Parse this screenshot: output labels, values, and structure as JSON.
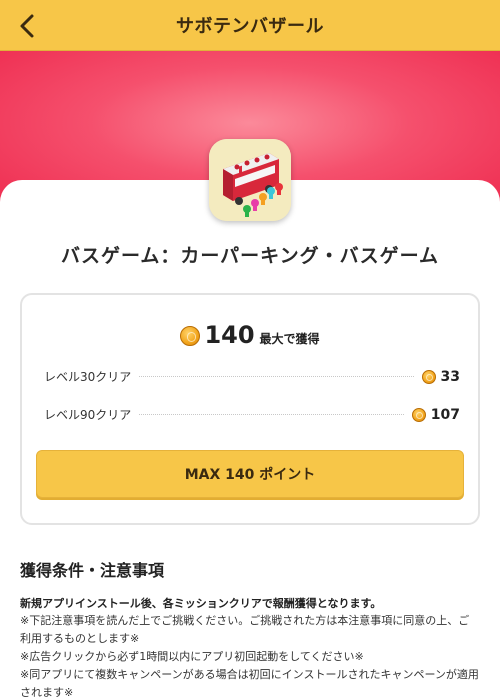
{
  "header": {
    "title": "サボテンバザール",
    "back_icon": "chevron-left-icon",
    "bg_color": "#f7c648"
  },
  "hero": {
    "gradient_color": "#f5506d"
  },
  "app": {
    "icon": "bus-game-app-icon",
    "title": "バスゲーム：カーパーキング・バスゲーム"
  },
  "reward": {
    "max_points": "140",
    "max_label": "最大で獲得",
    "levels": [
      {
        "label": "レベル30クリア",
        "points": "33"
      },
      {
        "label": "レベル90クリア",
        "points": "107"
      }
    ],
    "button_label": "MAX 140 ポイント"
  },
  "conditions": {
    "title": "獲得条件・注意事項",
    "lead": "新規アプリインストール後、各ミッションクリアで報酬獲得となります。",
    "notes": [
      "※下記注意事項を読んだ上でご挑戦ください。ご挑戦された方は本注意事項に同意の上、ご利用するものとします※",
      "※広告クリックから必ず1時間以内にアプリ初回起動をしてください※",
      "※同アプリにて複数キャンペーンがある場合は初回にインストールされたキャンペーンが適用されます※"
    ]
  }
}
